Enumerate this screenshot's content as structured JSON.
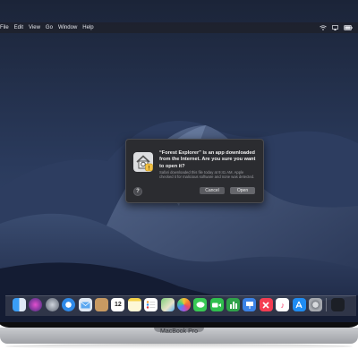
{
  "menubar": {
    "items": [
      "File",
      "Edit",
      "View",
      "Go",
      "Window",
      "Help"
    ],
    "status_icons": [
      "wifi-icon",
      "airplay-icon",
      "battery-icon"
    ]
  },
  "dialog": {
    "title": "“Forest Explorer” is an app downloaded from the Internet. Are you sure you want to open it?",
    "detail": "Safari downloaded this file today at 9:41 AM. Apple checked it for malicious software and none was detected.",
    "help_label": "?",
    "cancel_label": "Cancel",
    "open_label": "Open",
    "icon": "app-icon"
  },
  "dock": {
    "icons": [
      "finder-icon",
      "siri-icon",
      "launchpad-icon",
      "safari-icon",
      "mail-icon",
      "contacts-icon",
      "calendar-icon",
      "notes-icon",
      "reminders-icon",
      "maps-icon",
      "photos-icon",
      "messages-icon",
      "facetime-icon",
      "numbers-icon",
      "keynote-icon",
      "news-icon",
      "music-icon",
      "app-store-icon",
      "system-preferences-icon"
    ],
    "calendar_day": "12",
    "trash_icon": "trash-icon"
  },
  "device": {
    "label": "MacBook Pro"
  },
  "colors": {
    "bezel": "#0d0d0f",
    "dialog_bg": "#2b2c30",
    "dock_bg": "#464b5a"
  }
}
